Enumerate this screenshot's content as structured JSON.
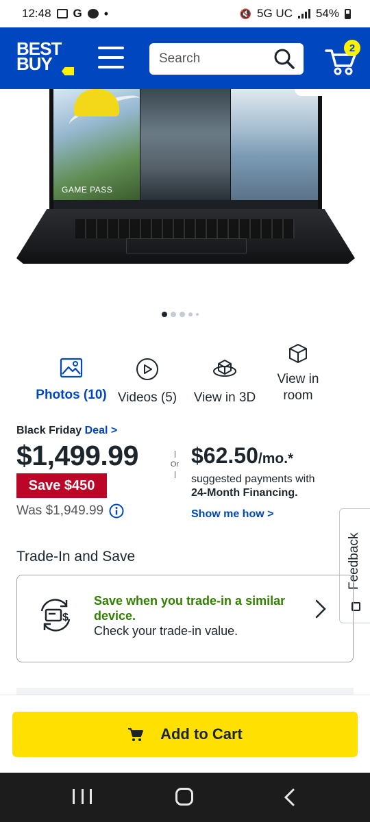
{
  "status_bar": {
    "time": "12:48",
    "g_label": "G",
    "dot": "•",
    "network": "5G UC",
    "battery": "54%"
  },
  "header": {
    "logo_line1": "BEST",
    "logo_line2": "BUY",
    "search_placeholder": "Search",
    "cart_count": "2",
    "brand_color": "#0046be",
    "accent_color": "#fff200"
  },
  "hero": {
    "overlay_text": "GAME PASS",
    "carousel_dots": 5,
    "active_dot": 0
  },
  "media": {
    "photos_label": "Photos (10)",
    "videos_label": "Videos (5)",
    "view3d_label": "View in 3D",
    "room_label_line1": "View in",
    "room_label_line2": "room"
  },
  "pricing": {
    "deal_prefix": "Black Friday",
    "deal_link": "Deal >",
    "price": "$1,499.99",
    "or": "Or",
    "save_label": "Save $450",
    "was_label": "Was $1,949.99",
    "monthly_amount": "$62.50",
    "monthly_suffix": "/mo.*",
    "financing_line1": "suggested payments with",
    "financing_line2": "24-Month Financing.",
    "show_link": "Show me how >"
  },
  "feedback": {
    "label": "Feedback"
  },
  "trade_in": {
    "title": "Trade-In and Save",
    "headline": "Save when you trade-in a similar device.",
    "subline": "Check your trade-in value."
  },
  "cart_bar": {
    "button_label": "Add to Cart",
    "button_color": "#ffe000"
  }
}
